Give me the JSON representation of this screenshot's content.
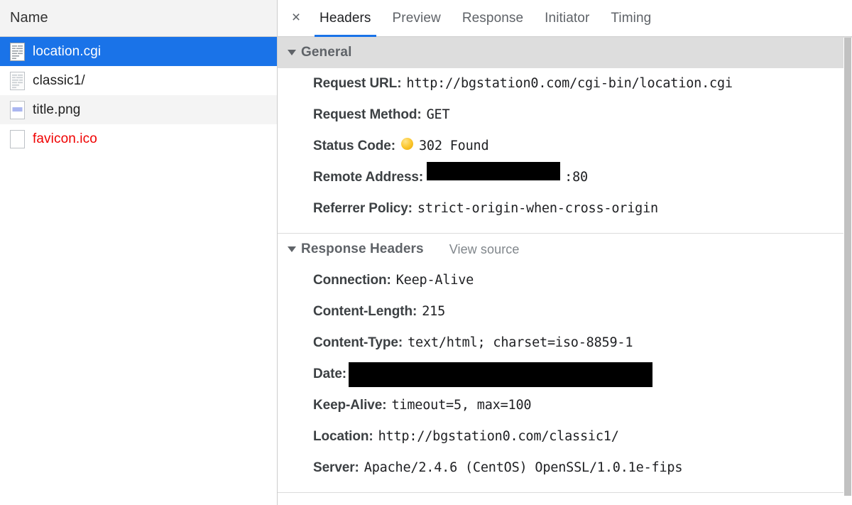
{
  "left_panel": {
    "column_header": "Name",
    "files": [
      {
        "name": "location.cgi",
        "icon": "document-icon",
        "selected": true,
        "striped": false,
        "error": false
      },
      {
        "name": "classic1/",
        "icon": "document-icon",
        "selected": false,
        "striped": false,
        "error": false
      },
      {
        "name": "title.png",
        "icon": "image-icon",
        "selected": false,
        "striped": true,
        "error": false
      },
      {
        "name": "favicon.ico",
        "icon": "blank-file-icon",
        "selected": false,
        "striped": false,
        "error": true
      }
    ]
  },
  "tabs": {
    "close_label": "×",
    "items": [
      {
        "label": "Headers",
        "active": true
      },
      {
        "label": "Preview",
        "active": false
      },
      {
        "label": "Response",
        "active": false
      },
      {
        "label": "Initiator",
        "active": false
      },
      {
        "label": "Timing",
        "active": false
      }
    ]
  },
  "general": {
    "title": "General",
    "rows": [
      {
        "key": "Request URL:",
        "value": "http://bgstation0.com/cgi-bin/location.cgi"
      },
      {
        "key": "Request Method:",
        "value": "GET"
      },
      {
        "key": "Status Code:",
        "value": "302 Found",
        "status_dot": true,
        "status_color": "#fcc934"
      },
      {
        "key": "Remote Address:",
        "value": ":80",
        "redacted": "remote"
      },
      {
        "key": "Referrer Policy:",
        "value": "strict-origin-when-cross-origin"
      }
    ]
  },
  "response_headers": {
    "title": "Response Headers",
    "view_source": "View source",
    "rows": [
      {
        "key": "Connection:",
        "value": "Keep-Alive"
      },
      {
        "key": "Content-Length:",
        "value": "215"
      },
      {
        "key": "Content-Type:",
        "value": "text/html; charset=iso-8859-1"
      },
      {
        "key": "Date:",
        "value": "",
        "redacted": "date"
      },
      {
        "key": "Keep-Alive:",
        "value": "timeout=5, max=100"
      },
      {
        "key": "Location:",
        "value": "http://bgstation0.com/classic1/"
      },
      {
        "key": "Server:",
        "value": "Apache/2.4.6 (CentOS) OpenSSL/1.0.1e-fips"
      }
    ]
  },
  "colors": {
    "selection_blue": "#1a73e8",
    "error_red": "#f00000",
    "status_yellow": "#fcc934",
    "section_gray": "#dddddd"
  }
}
